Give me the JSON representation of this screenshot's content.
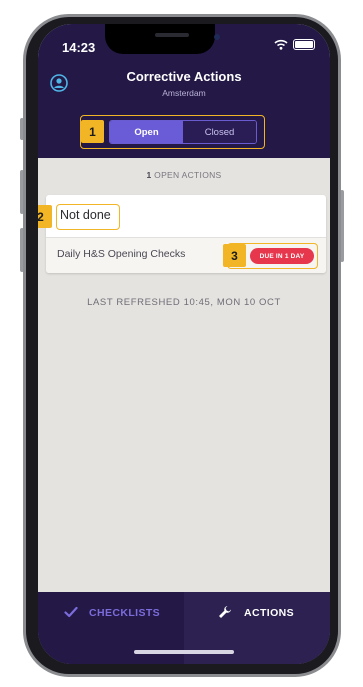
{
  "status_bar": {
    "time": "14:23",
    "icons": [
      "wifi-icon",
      "battery-icon"
    ]
  },
  "header": {
    "title": "Corrective Actions",
    "subtitle": "Amsterdam",
    "icon": "user-circle-icon"
  },
  "segmented": {
    "options": [
      "Open",
      "Closed"
    ],
    "selected": "Open"
  },
  "annotations": [
    "1",
    "2",
    "3"
  ],
  "summary": {
    "count": "1",
    "label": "OPEN ACTIONS"
  },
  "action_card": {
    "status": "Not done",
    "checklist": "Daily H&S Opening Checks",
    "due": "DUE IN 1 DAY"
  },
  "refreshed": "LAST REFRESHED 10:45, MON 10 OCT",
  "nav": {
    "checklists": {
      "label": "CHECKLISTS",
      "icon": "check-icon"
    },
    "actions": {
      "label": "ACTIONS",
      "icon": "wrench-icon",
      "active": true
    }
  },
  "colors": {
    "header_bg": "#241846",
    "accent": "#6a5bd6",
    "highlight": "#f1b525",
    "due_red": "#e6374d",
    "body_bg": "#e4e3df"
  }
}
